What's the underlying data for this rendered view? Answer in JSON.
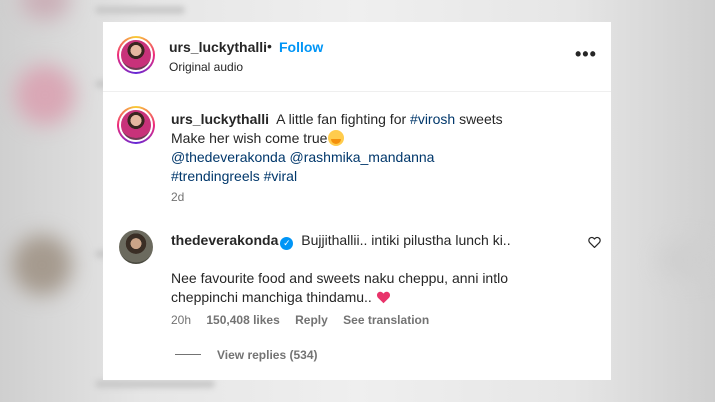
{
  "post": {
    "username": "urs_luckythalli",
    "separator": "•",
    "follow_label": "Follow",
    "audio": "Original audio",
    "more_label": "•••"
  },
  "caption": {
    "username": "urs_luckythalli",
    "text_1": "A little fan fighting for",
    "hashtag_virosh": "#virosh",
    "text_2": "sweets",
    "line_2": "Make her wish come true",
    "mention_1": "@thedeverakonda",
    "mention_2": "@rashmika_mandanna",
    "hashtag_trending": "#trendingreels",
    "hashtag_viral": "#viral",
    "time": "2d"
  },
  "comment": {
    "username": "thedeverakonda",
    "verified_mark": "✓",
    "line_1": "Bujjithallii.. intiki pilustha lunch ki..",
    "line_2": "Nee favourite food and sweets naku cheppu, anni intlo cheppinchi manchiga thindamu..",
    "time": "20h",
    "likes": "150,408 likes",
    "reply_label": "Reply",
    "translate_label": "See translation",
    "view_replies": "View replies (534)"
  },
  "icons": {
    "heart_outline": "heart-outline-icon",
    "hug_emoji": "hugging-face-emoji",
    "pink_heart": "pink-heart-emoji"
  },
  "colors": {
    "follow": "#0095f6",
    "link": "#00376b",
    "secondary_text": "#737373",
    "pink_heart": "#e8336a"
  }
}
